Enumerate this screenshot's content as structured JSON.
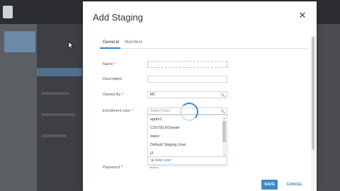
{
  "modal": {
    "title": "Add Staging",
    "close_glyph": "✕",
    "tabs": [
      {
        "label": "General",
        "active": true
      },
      {
        "label": "Manifest",
        "active": false
      }
    ]
  },
  "form": {
    "name_label": "Name",
    "description_label": "Description",
    "owned_by_label": "Owned By",
    "owned_by_value": "MI",
    "enrollment_user_label": "Enrollment User",
    "enrollment_user_placeholder": "Select User",
    "required_mark": "*",
    "search_glyph": "🔍",
    "truncated_label": "Password",
    "truncated_value": "•••••••••"
  },
  "dropdown": {
    "options": [
      "apple1",
      "CSV7ELR1tester",
      "dawn",
      "Default Staging User",
      "j3"
    ],
    "add_user_label": "Add User",
    "add_glyph": "⊕"
  },
  "footer": {
    "save_label": "SAVE",
    "cancel_label": "CANCEL"
  },
  "colors": {
    "accent": "#3a8ad0",
    "required": "#d33333",
    "overlay": "#3d3f42"
  },
  "icons": [
    "close-icon",
    "search-icon",
    "add-icon",
    "cursor-icon"
  ]
}
